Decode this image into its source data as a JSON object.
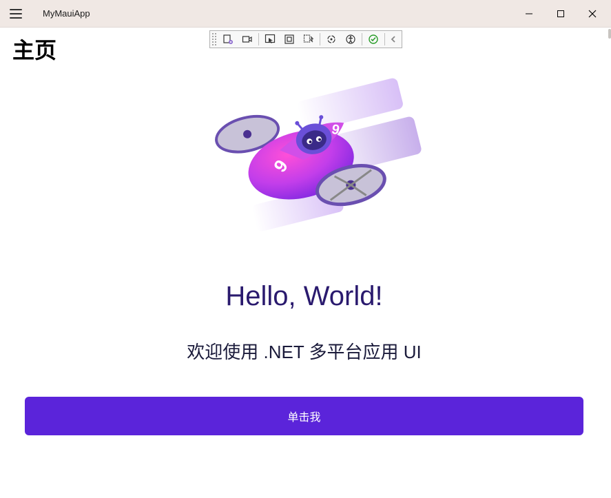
{
  "titlebar": {
    "app_title": "MyMauiApp"
  },
  "page": {
    "header": "主页",
    "headline": "Hello, World!",
    "subheadline": "欢迎使用 .NET 多平台应用 UI",
    "button_label": "单击我"
  },
  "debug_toolbar": {
    "icons": [
      "live-visual-tree",
      "camera",
      "select-element",
      "layout-adorners",
      "hot-reload",
      "track-focus",
      "accessibility",
      "check",
      "collapse"
    ]
  },
  "colors": {
    "accent": "#5b24da",
    "headline": "#2a1a6e",
    "titlebar_bg": "#f0e8e4"
  }
}
